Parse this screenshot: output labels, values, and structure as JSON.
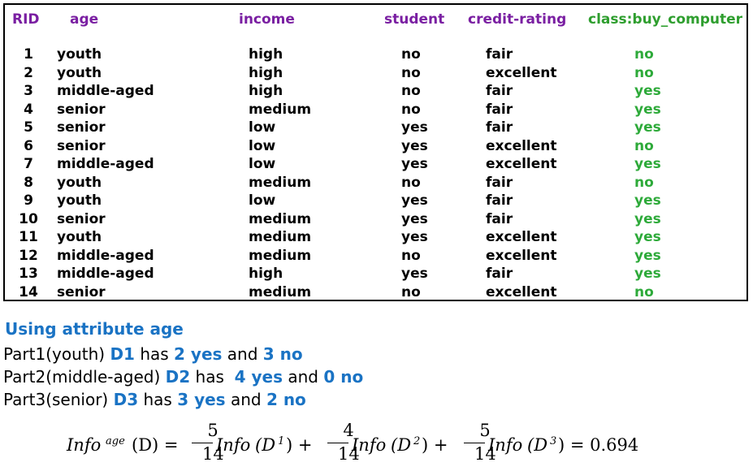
{
  "headers": {
    "rid": "RID",
    "age": "age",
    "income": "income",
    "student": "student",
    "credit": "credit-rating",
    "class": "class:buy_computer"
  },
  "rows": [
    {
      "rid": "1",
      "age": "youth",
      "income": "high",
      "student": "no",
      "credit": "fair",
      "class": "no"
    },
    {
      "rid": "2",
      "age": "youth",
      "income": "high",
      "student": "no",
      "credit": "excellent",
      "class": "no"
    },
    {
      "rid": "3",
      "age": "middle-aged",
      "income": "high",
      "student": "no",
      "credit": "fair",
      "class": "yes"
    },
    {
      "rid": "4",
      "age": "senior",
      "income": "medium",
      "student": "no",
      "credit": "fair",
      "class": "yes"
    },
    {
      "rid": "5",
      "age": "senior",
      "income": "low",
      "student": "yes",
      "credit": "fair",
      "class": "yes"
    },
    {
      "rid": "6",
      "age": "senior",
      "income": "low",
      "student": "yes",
      "credit": "excellent",
      "class": "no"
    },
    {
      "rid": "7",
      "age": "middle-aged",
      "income": "low",
      "student": "yes",
      "credit": "excellent",
      "class": "yes"
    },
    {
      "rid": "8",
      "age": "youth",
      "income": "medium",
      "student": "no",
      "credit": "fair",
      "class": "no"
    },
    {
      "rid": "9",
      "age": "youth",
      "income": "low",
      "student": "yes",
      "credit": "fair",
      "class": "yes"
    },
    {
      "rid": "10",
      "age": "senior",
      "income": "medium",
      "student": "yes",
      "credit": "fair",
      "class": "yes"
    },
    {
      "rid": "11",
      "age": "youth",
      "income": "medium",
      "student": "yes",
      "credit": "excellent",
      "class": "yes"
    },
    {
      "rid": "12",
      "age": "middle-aged",
      "income": "medium",
      "student": "no",
      "credit": "excellent",
      "class": "yes"
    },
    {
      "rid": "13",
      "age": "middle-aged",
      "income": "high",
      "student": "yes",
      "credit": "fair",
      "class": "yes"
    },
    {
      "rid": "14",
      "age": "senior",
      "income": "medium",
      "student": "no",
      "credit": "excellent",
      "class": "no"
    }
  ],
  "section_title": "Using attribute age",
  "parts": [
    {
      "prefix": "Part1(youth) ",
      "dname": "D1",
      "mid1": " has ",
      "yes": "2 yes",
      "mid2": " and ",
      "no": "3 no"
    },
    {
      "prefix": "Part2(middle-aged) ",
      "dname": "D2",
      "mid1": " has  ",
      "yes": "4 yes",
      "mid2": " and ",
      "no": "0 no"
    },
    {
      "prefix": "Part3(senior) ",
      "dname": "D3",
      "mid1": " has ",
      "yes": "3 yes",
      "mid2": " and ",
      "no": "2 no"
    }
  ],
  "formula": {
    "lhs_info": "Info",
    "lhs_sub": "age",
    "lhs_arg": "(D) =",
    "terms": [
      {
        "num": "5",
        "den": "14",
        "info": "Info",
        "arg": "(D",
        "sub": "1",
        "close": ") +"
      },
      {
        "num": "4",
        "den": "14",
        "info": "Info",
        "arg": "(D",
        "sub": "2",
        "close": ") +"
      },
      {
        "num": "5",
        "den": "14",
        "info": "Info",
        "arg": "(D",
        "sub": "3",
        "close": ") = 0.694"
      }
    ]
  },
  "colors": {
    "header_purple": "#7a1fa2",
    "header_green": "#2e9e2e",
    "class_green": "#2eaa3a",
    "highlight_blue": "#1a73c4"
  }
}
